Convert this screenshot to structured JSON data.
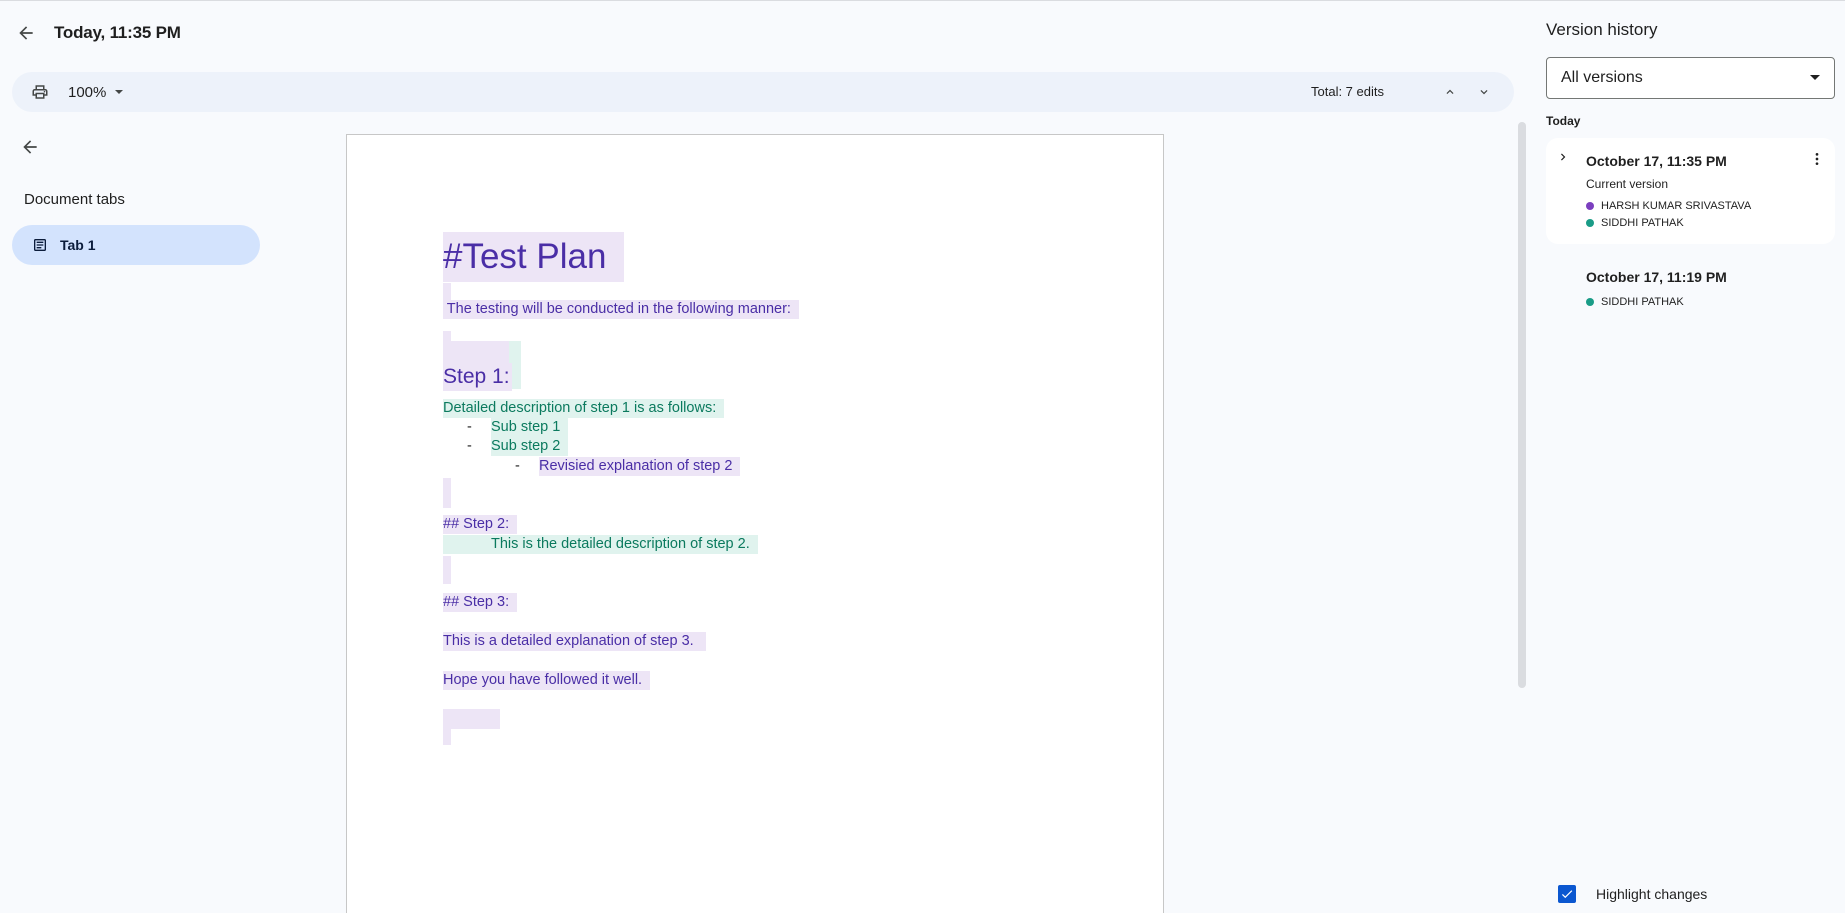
{
  "header": {
    "title": "Today, 11:35 PM"
  },
  "toolbar": {
    "zoom": "100%",
    "total_edits": "Total: 7 edits"
  },
  "left_panel": {
    "section_label": "Document tabs",
    "tabs": [
      {
        "label": "Tab 1"
      }
    ]
  },
  "document": {
    "title": "#Test Plan",
    "intro": " The testing will be conducted in the following manner:",
    "step1_heading": "Step 1:",
    "step1_desc": "Detailed description of step 1 is as follows:",
    "bullet_marker": "-",
    "substep1": "Sub step 1",
    "substep2": "Sub step 2",
    "revised": "Revisied explanation of step 2",
    "step2_heading": "## Step 2:",
    "step2_desc": "This is the detailed description of step 2.",
    "step3_heading": "## Step 3:",
    "step3_desc": "This is a detailed explanation of step 3.",
    "closing": "Hope you have followed it well."
  },
  "version_history": {
    "title": "Version history",
    "filter": "All versions",
    "group_label": "Today",
    "versions": [
      {
        "date": "October 17, 11:35 PM",
        "subtitle": "Current version",
        "users": [
          {
            "name": "HARSH KUMAR SRIVASTAVA",
            "color": "#7b3fbf"
          },
          {
            "name": "SIDDHI PATHAK",
            "color": "#1a9c87"
          }
        ]
      },
      {
        "date": "October 17, 11:19 PM",
        "users": [
          {
            "name": "SIDDHI PATHAK",
            "color": "#1a9c87"
          }
        ]
      }
    ],
    "highlight_label": "Highlight changes",
    "highlight_checked": true
  },
  "colors": {
    "accent": "#0b57d0",
    "purple_author": "#7b3fbf",
    "green_author": "#1a9c87"
  }
}
